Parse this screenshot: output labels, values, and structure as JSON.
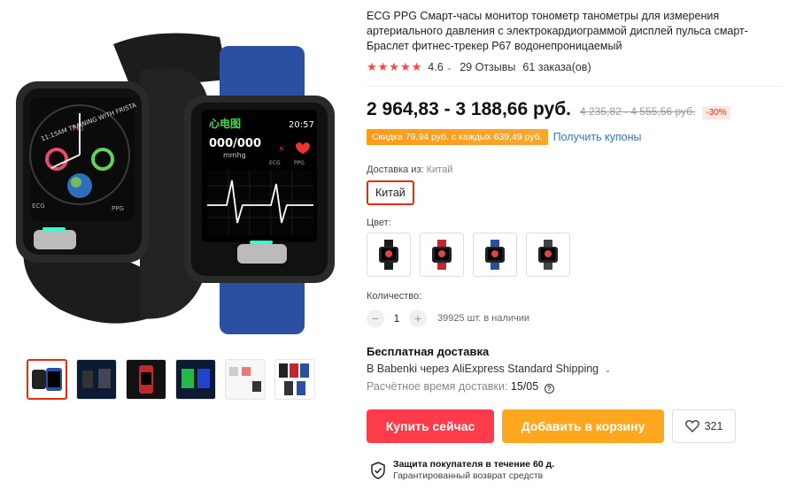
{
  "product": {
    "title": "ECG PPG Смарт-часы монитор тонометр танометры для измерения артериального давления с электрокардиограммой дисплей пульса смарт-Браслет фитнес-трекер P67 водонепроницаемый",
    "rating": "4.6",
    "stars": "★★★★★",
    "reviews": "29 Отзывы",
    "orders": "61 заказа(ов)"
  },
  "watch_screens": {
    "left_label": "11:15AM TRAINING WITH FRISTA",
    "left_sub": "FRI",
    "left_ecg": "ECG",
    "left_ppg": "PPG",
    "right_heading": "心电图",
    "right_time": "20:57",
    "right_reading": "000/000",
    "right_unit": "mmhg",
    "right_ecg": "ECG",
    "right_ppg": "PPG"
  },
  "price": {
    "current": "2 964,83 - 3 188,66 руб.",
    "old": "4 235,82 - 4 555,56 руб.",
    "discount": "-30%"
  },
  "promo": {
    "badge": "Скидка 79,94 руб. с каждых 639,49 руб.",
    "coupons": "Получить купоны"
  },
  "shipping_from": {
    "label": "Доставка из:",
    "value": "Китай",
    "selected": "Китай"
  },
  "color": {
    "label": "Цвет:",
    "options": [
      "black",
      "red",
      "blue",
      "black-metal"
    ]
  },
  "quantity": {
    "label": "Количество:",
    "minus": "−",
    "value": "1",
    "plus": "+",
    "stock": "39925 шт. в наличии"
  },
  "delivery": {
    "free": "Бесплатная доставка",
    "via": "В Babenki через AliExpress Standard Shipping",
    "caret": "⌄",
    "time_label": "Расчётное время доставки:",
    "time_value": "15/05",
    "help": "?"
  },
  "actions": {
    "buy": "Купить сейчас",
    "cart": "Добавить в корзину",
    "wish_count": "321"
  },
  "protection": {
    "title": "Защита покупателя в течение 60 д.",
    "sub": "Гарантированный возврат средств"
  },
  "colors": {
    "accent": "#e62e04",
    "buy": "#fe3b4b",
    "cart": "#fea71f",
    "promo": "#ff9a1a",
    "link": "#2e77c8",
    "star": "#ff4444"
  }
}
